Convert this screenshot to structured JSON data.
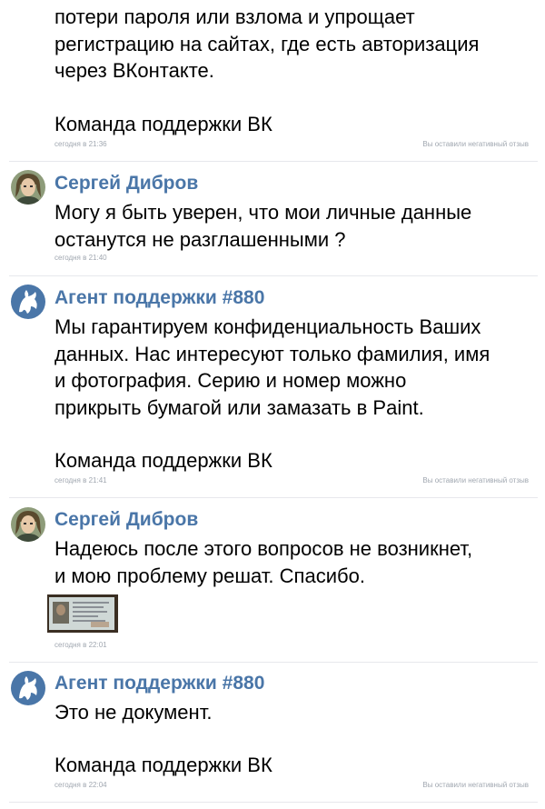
{
  "messages": [
    {
      "id": "m0",
      "author": "",
      "lines": [
        "потери пароля или взлома и упрощает",
        "регистрацию на сайтах, где есть авторизация",
        "через ВКонтакте."
      ],
      "signature": "Команда поддержки ВК",
      "time": "сегодня в 21:36",
      "feedback": "Вы оставили негативный отзыв"
    },
    {
      "id": "m1",
      "author": "Сергей Дибров",
      "lines": [
        "Могу я быть уверен, что мои личные данные",
        "останутся не разглашенными ?"
      ],
      "time": "сегодня в 21:40"
    },
    {
      "id": "m2",
      "author": "Агент поддержки #880",
      "lines": [
        "Мы гарантируем конфиденциальность Ваших",
        "данных. Нас интересуют только фамилия, имя",
        "и фотография. Серию и номер можно",
        "прикрыть бумагой или замазать в Paint."
      ],
      "signature": "Команда поддержки ВК",
      "time": "сегодня в 21:41",
      "feedback": "Вы оставили негативный отзыв"
    },
    {
      "id": "m3",
      "author": "Сергей Дибров",
      "lines": [
        "Надеюсь после этого вопросов не возникнет,",
        "и мою проблему решат. Спасибо."
      ],
      "time": "сегодня в 22:01",
      "attachment": "document-photo"
    },
    {
      "id": "m4",
      "author": "Агент поддержки #880",
      "lines": [
        "Это не документ."
      ],
      "signature": "Команда поддержки ВК",
      "time": "сегодня в 22:04",
      "feedback": "Вы оставили негативный отзыв"
    }
  ],
  "colors": {
    "author": "#4a76a8",
    "meta": "#a0a7b0",
    "separator": "#e7e8ec"
  }
}
